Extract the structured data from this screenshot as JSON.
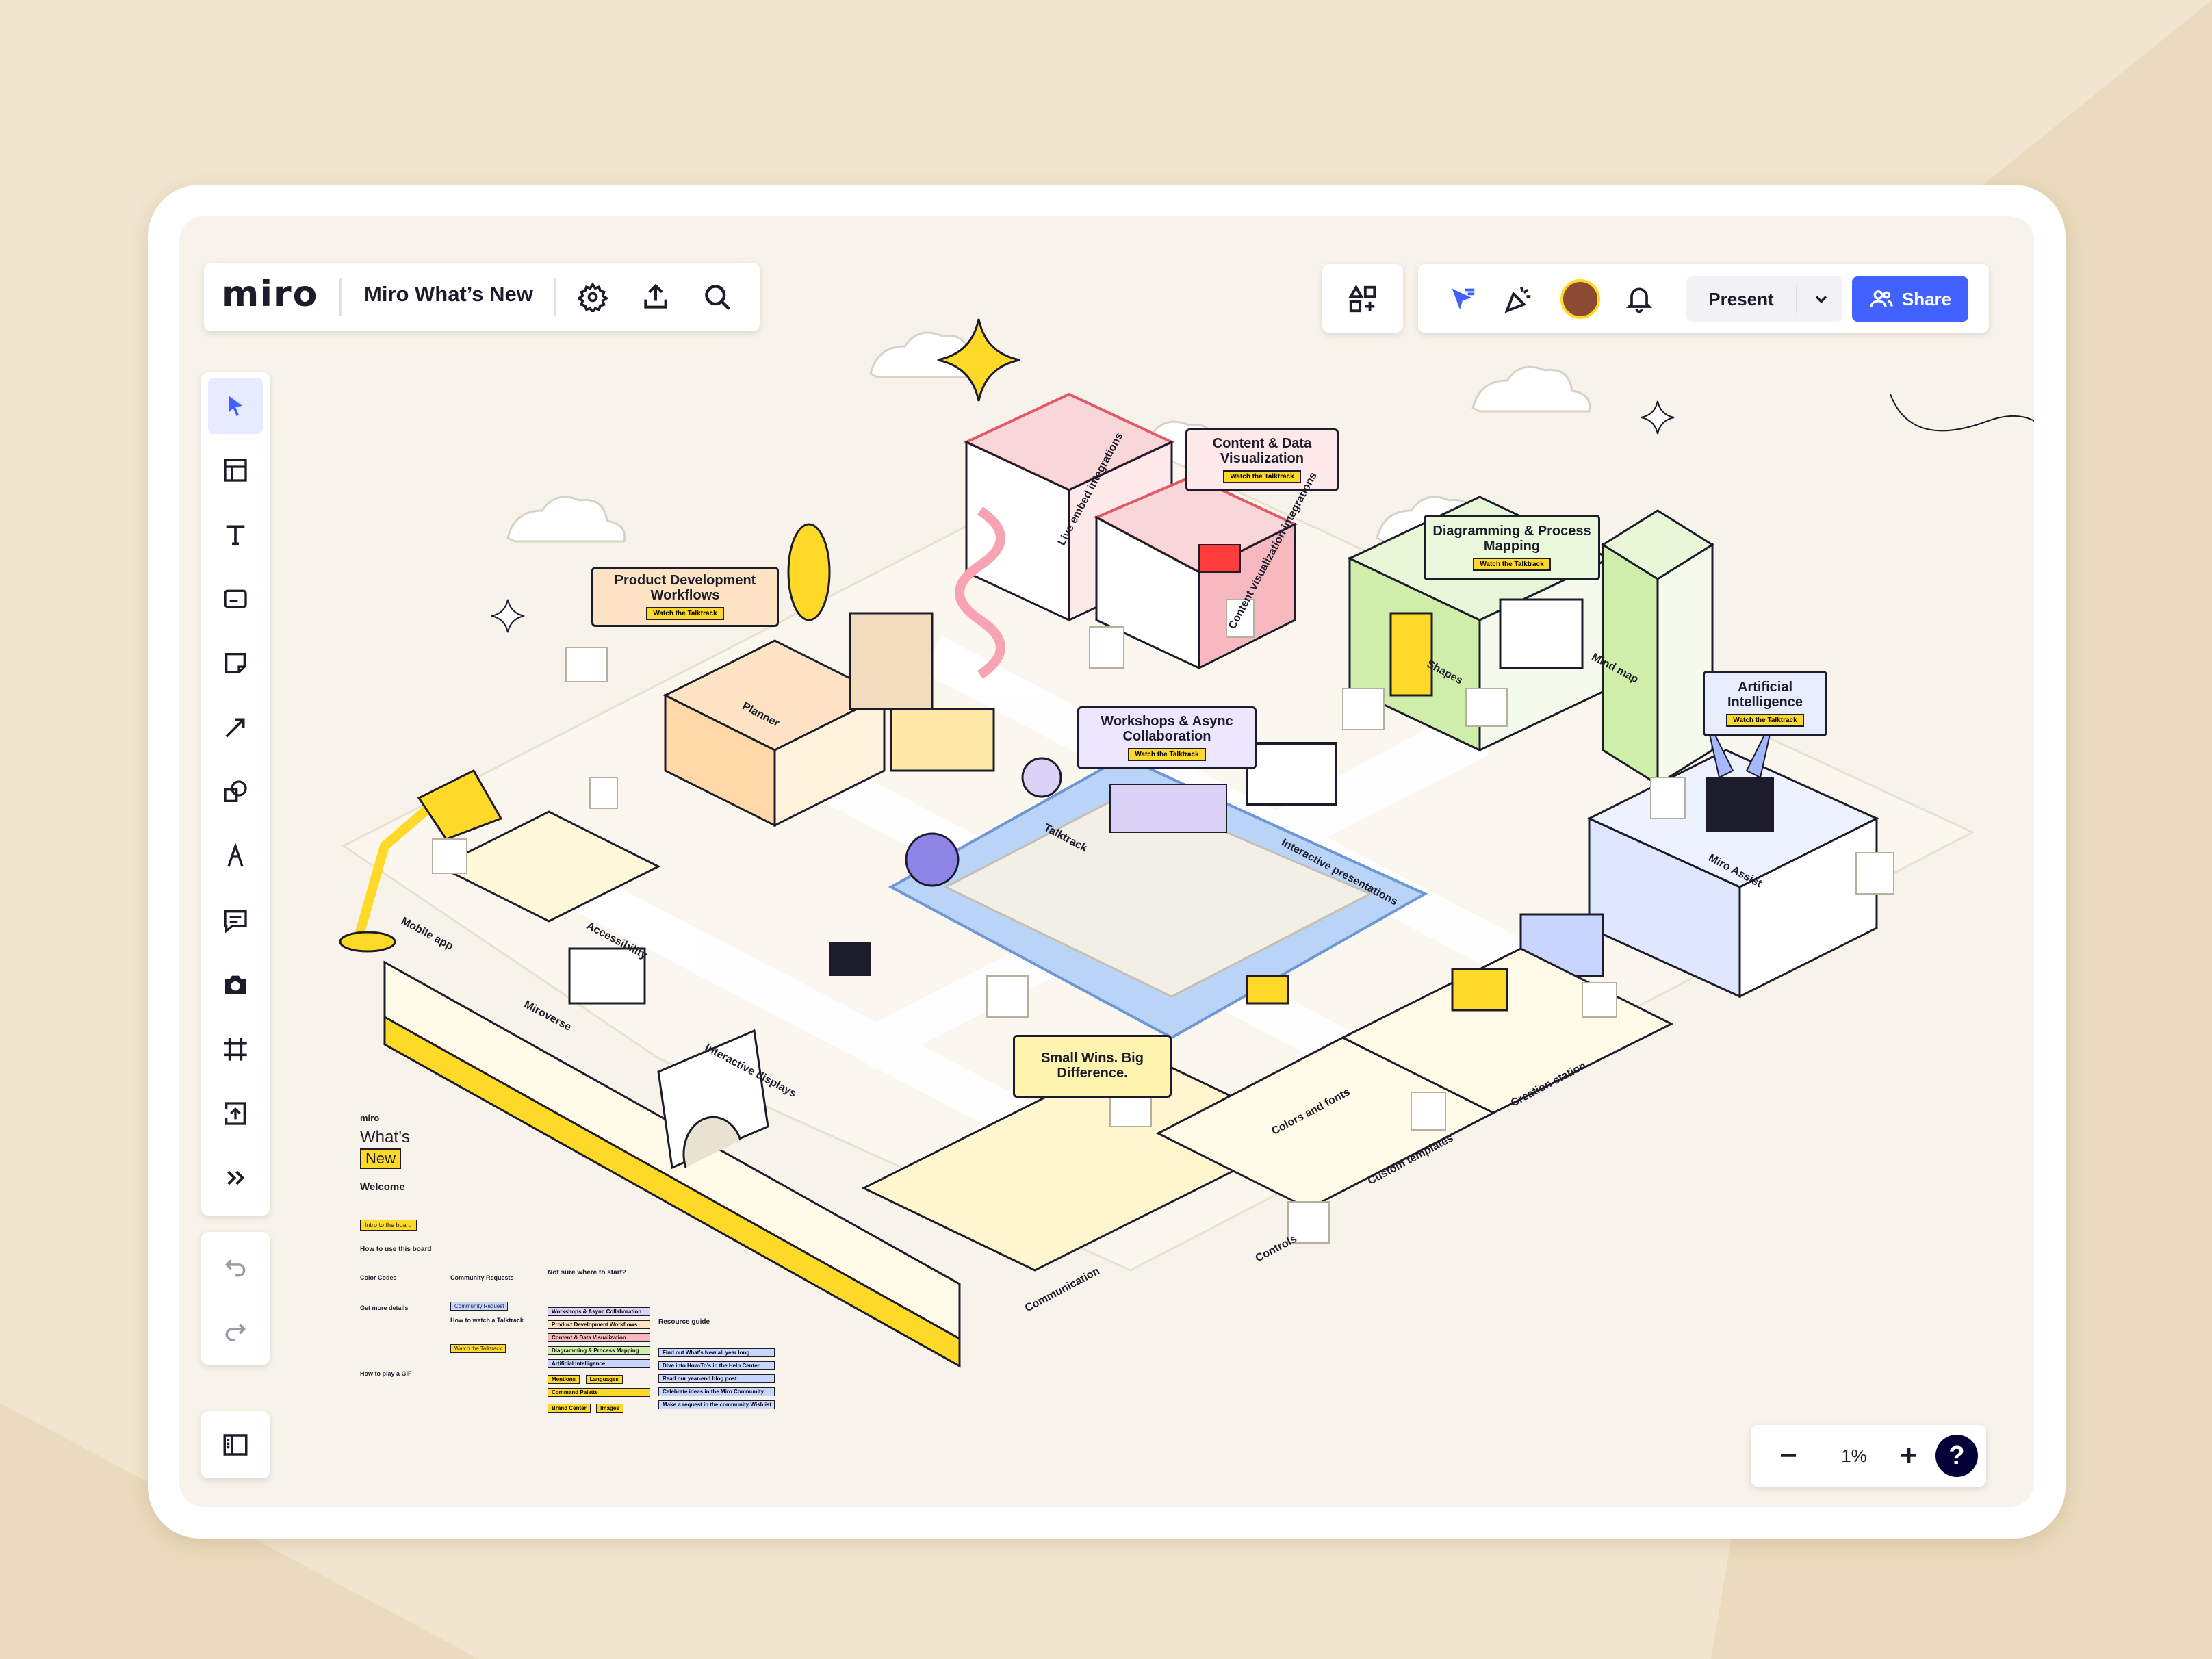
{
  "app": {
    "logo": "miro",
    "board_title": "Miro What’s New"
  },
  "colors": {
    "share_blue": "#4262ff",
    "accent_yellow": "#ffd928",
    "ink": "#1c1c2a"
  },
  "top_bar": {
    "present_label": "Present",
    "share_label": "Share"
  },
  "toolbar_icons": [
    "select-icon",
    "templates-icon",
    "text-icon",
    "card-icon",
    "sticky-note-icon",
    "connector-icon",
    "shapes-icon",
    "pen-icon",
    "comment-icon",
    "camera-icon",
    "frame-icon",
    "upload-icon",
    "more-tools-icon",
    "undo-icon",
    "redo-icon"
  ],
  "zoom": {
    "minus": "−",
    "value": "1%",
    "plus": "+",
    "help": "?"
  },
  "areas": [
    {
      "title": "Product Development Workflows",
      "tag": "Watch the Talktrack"
    },
    {
      "title": "Content & Data Visualization",
      "tag": "Watch the Talktrack"
    },
    {
      "title": "Diagramming & Process Mapping",
      "tag": "Watch the Talktrack"
    },
    {
      "title": "Artificial Intelligence",
      "tag": "Watch the Talktrack"
    },
    {
      "title": "Workshops & Async Collaboration",
      "tag": "Watch the Talktrack"
    },
    {
      "title": "Small Wins. Big Difference.",
      "tag": ""
    }
  ],
  "map_labels": {
    "live_embed": "Live embed integrations",
    "content_viz": "Content visualization integrations",
    "planner": "Planner",
    "shapes": "Shapes",
    "mind_map": "Mind map",
    "talktrack": "Talktrack",
    "interactive_presentations": "Interactive presentations",
    "miro_assist": "Miro Assist",
    "mobile_app": "Mobile app",
    "accessibility": "Accessibility",
    "miroverse": "Miroverse",
    "interactive_displays": "Interactive displays",
    "colors_and_fonts": "Colors and fonts",
    "creation_station": "Creation station",
    "custom_templates": "Custom templates",
    "controls": "Controls",
    "communication": "Communication"
  },
  "legend": {
    "brand": "miro",
    "whats": "What’s",
    "new": "New",
    "welcome": "Welcome",
    "intro_btn": "Intro to the board",
    "how_to_use": "How to use this board",
    "color_codes": "Color Codes",
    "get_more_details": "Get more details",
    "how_to_play_gif": "How to play a GIF",
    "community_requests": "Community Requests",
    "community_request_chip": "Community Request",
    "how_to_watch": "How to watch a Talktrack",
    "watch_chip": "Watch the Talktrack",
    "not_sure": "Not sure where to start?",
    "topics": [
      "Workshops & Async Collaboration",
      "Product Development Workflows",
      "Content & Data Visualization",
      "Diagramming & Process Mapping",
      "Artificial Intelligence",
      "Mentions",
      "Languages",
      "Command Palette",
      "Brand Center",
      "Images"
    ],
    "resource_guide": "Resource guide",
    "resources": [
      "Find out What’s New all year long",
      "Dive into How-To’s in the Help Center",
      "Read our year-end blog post",
      "Celebrate ideas in the Miro Community",
      "Make a request in the community Wishlist"
    ]
  }
}
